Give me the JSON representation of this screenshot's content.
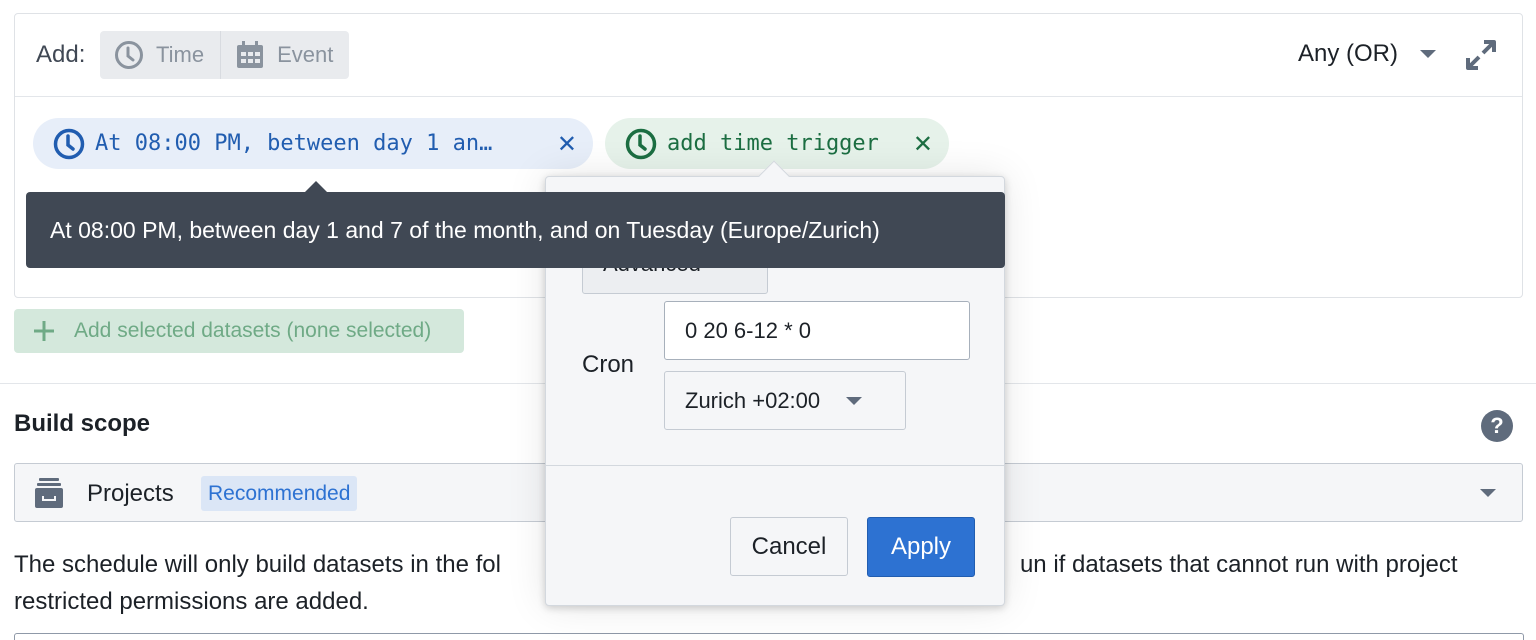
{
  "trigger_panel": {
    "add_label": "Add:",
    "add_buttons": [
      {
        "label": "Time",
        "icon": "clock-icon"
      },
      {
        "label": "Event",
        "icon": "calendar-icon"
      }
    ],
    "combinator": {
      "selected": "Any (OR)"
    },
    "expand_icon": "expand-icon",
    "tags": [
      {
        "label": "At 08:00 PM, between day 1 an…",
        "color": "#215db0",
        "icon": "clock-icon"
      },
      {
        "label": "add time trigger",
        "color": "#1c6e42",
        "icon": "clock-icon"
      }
    ]
  },
  "tooltip": {
    "text": "At 08:00 PM, between day 1 and 7 of the month, and on Tuesday (Europe/Zurich)"
  },
  "add_datasets_button": {
    "label": "Add selected datasets (none selected)"
  },
  "build_scope": {
    "title": "Build scope",
    "select": {
      "label": "Projects",
      "badge": "Recommended"
    },
    "description": "The schedule will only build datasets in the following projects. The schedule will fail to run if datasets that cannot run with project restricted permissions are added.",
    "description_visible_left": "The schedule will only build datasets in the fol",
    "description_visible_right": "un if datasets that cannot run with project",
    "description_line2": "restricted permissions are added."
  },
  "popover": {
    "mode_select": "Advanced",
    "cron_label": "Cron",
    "cron_value": "0 20 6-12 * 0",
    "timezone": "Zurich +02:00",
    "cancel_label": "Cancel",
    "apply_label": "Apply"
  },
  "colors": {
    "primary": "#2d72d2",
    "tooltip_bg": "#404854",
    "success_tag_bg": "#e6f2ea",
    "primary_tag_bg": "#e7eef9"
  }
}
